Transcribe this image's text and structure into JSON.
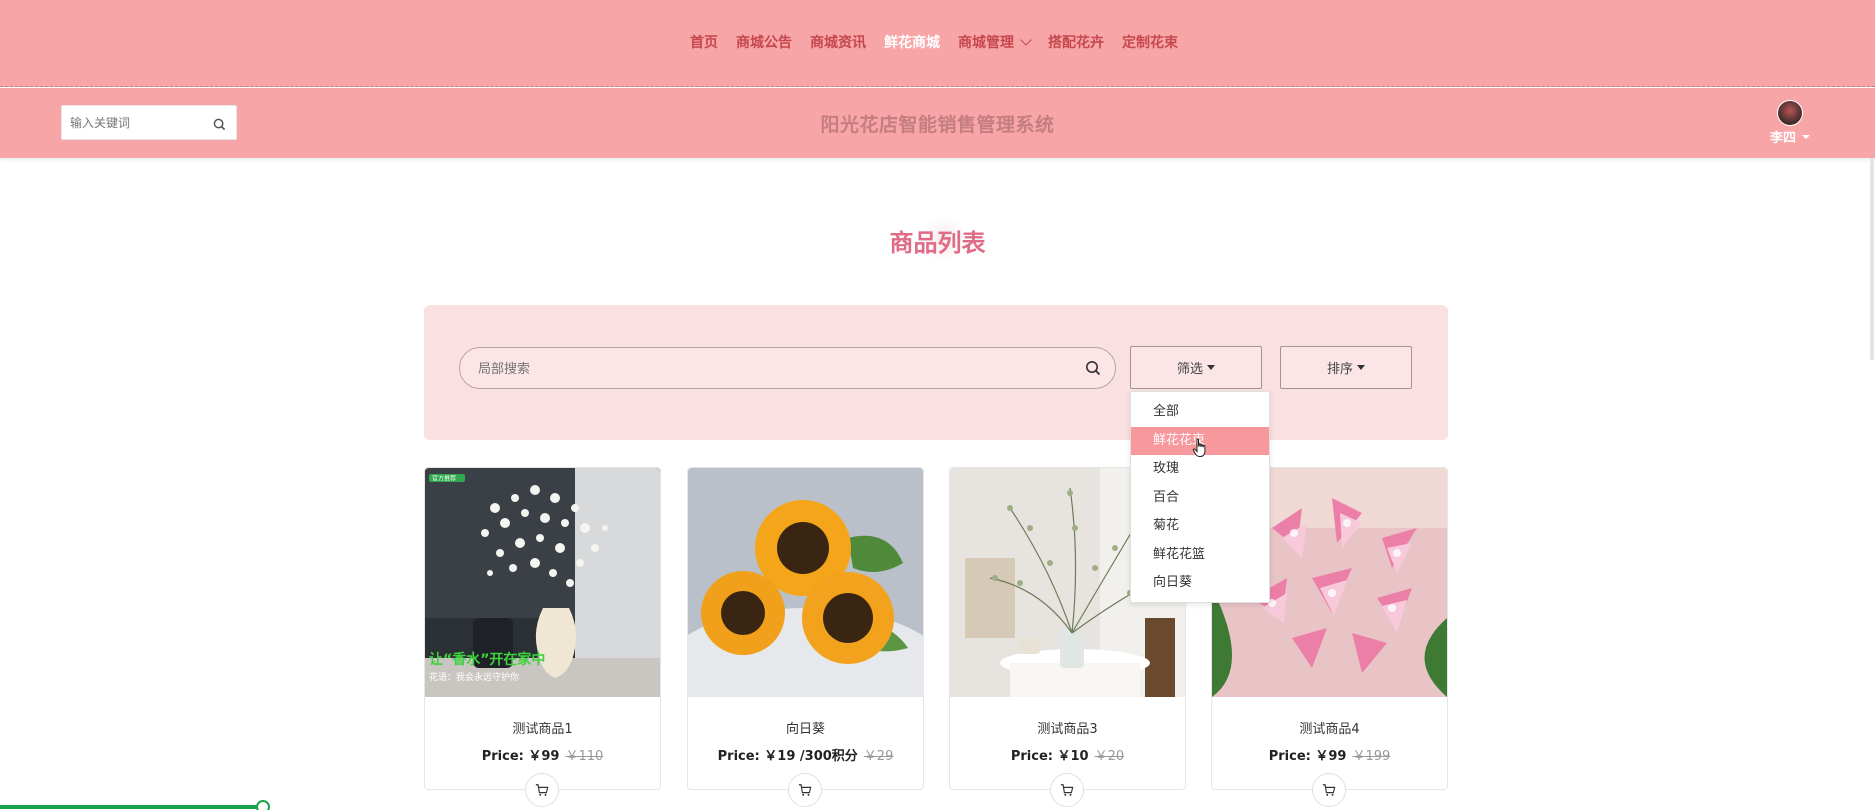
{
  "nav": {
    "items": [
      {
        "label": "首页"
      },
      {
        "label": "商城公告"
      },
      {
        "label": "商城资讯"
      },
      {
        "label": "鲜花商城"
      },
      {
        "label": "商城管理"
      },
      {
        "label": "搭配花卉"
      },
      {
        "label": "定制花束"
      }
    ],
    "active_index": 3
  },
  "header": {
    "search_placeholder": "输入关键词",
    "title": "阳光花店智能销售管理系统",
    "user_name": "李四"
  },
  "section": {
    "title": "商品列表"
  },
  "filter": {
    "search_placeholder": "局部搜索",
    "filter_label": "筛选",
    "sort_label": "排序",
    "dropdown_options": [
      {
        "label": "全部"
      },
      {
        "label": "鲜花花束"
      },
      {
        "label": "玫瑰"
      },
      {
        "label": "百合"
      },
      {
        "label": "菊花"
      },
      {
        "label": "鲜花花篮"
      },
      {
        "label": "向日葵"
      }
    ],
    "hovered_index": 1
  },
  "products": [
    {
      "name": "测试商品1",
      "price": "Price: ￥99",
      "old_price": "￥110",
      "image_text_main": "让“香水”开在家中",
      "image_text_sub": "花语：我会永远守护你",
      "image_tag": "官方推荐"
    },
    {
      "name": "向日葵",
      "price": "Price: ￥19 /300积分",
      "old_price": "￥29"
    },
    {
      "name": "测试商品3",
      "price": "Price: ￥10",
      "old_price": "￥20"
    },
    {
      "name": "测试商品4",
      "price": "Price: ￥99",
      "old_price": "￥199"
    }
  ],
  "progress": {
    "fraction": 0.14
  },
  "colors": {
    "header_pink": "#f8a5a8",
    "nav_text": "#c4484e",
    "title_pink": "#e06b86",
    "panel_pink": "#fbe0e1",
    "dropdown_hover": "#f7999c",
    "progress_green": "#1aa34a"
  },
  "icons": {
    "search": "search-icon",
    "cart": "cart-icon",
    "chevron": "chevron-down-icon",
    "caret": "caret-down-icon",
    "cursor": "hand-cursor-icon"
  }
}
